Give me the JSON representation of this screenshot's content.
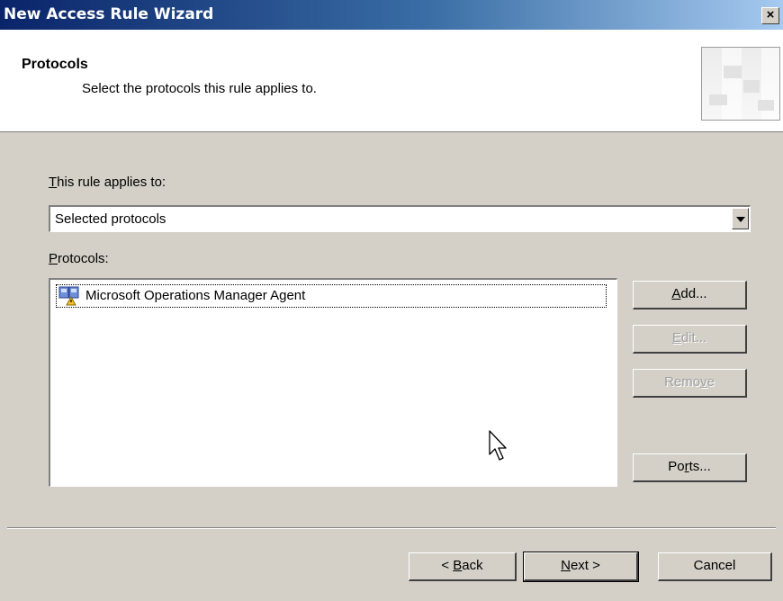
{
  "window": {
    "title": "New Access Rule Wizard",
    "close_label": "×"
  },
  "header": {
    "title": "Protocols",
    "subtitle": "Select the protocols this rule applies to."
  },
  "applies_to": {
    "label_accel": "T",
    "label_rest": "his rule applies to:",
    "selected": "Selected protocols"
  },
  "protocols": {
    "label_accel": "P",
    "label_rest": "rotocols:",
    "items": [
      {
        "label": "Microsoft Operations Manager Agent",
        "icon": "protocol-icon"
      }
    ]
  },
  "side_buttons": {
    "add": {
      "accel": "A",
      "rest": "dd...",
      "enabled": true
    },
    "edit": {
      "accel": "E",
      "rest": "dit...",
      "enabled": false
    },
    "remove": {
      "pre": "Remo",
      "accel": "v",
      "rest": "e",
      "enabled": false
    },
    "ports": {
      "pre": "Po",
      "accel": "r",
      "rest": "ts...",
      "enabled": true
    }
  },
  "footer": {
    "back": {
      "pre": "< ",
      "accel": "B",
      "rest": "ack"
    },
    "next": {
      "accel": "N",
      "rest": "ext >"
    },
    "cancel": "Cancel"
  },
  "colors": {
    "dialog_bg": "#d4d0c8",
    "titlebar_start": "#0a246a",
    "titlebar_end": "#a6caf0",
    "disabled_text": "#a0a0a0"
  }
}
